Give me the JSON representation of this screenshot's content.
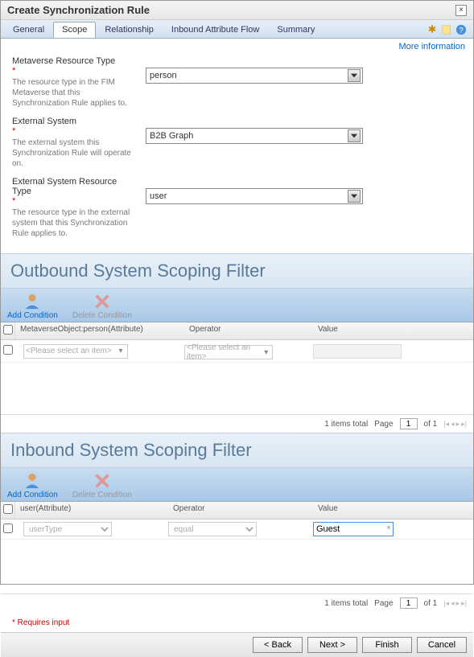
{
  "dialog": {
    "title": "Create Synchronization Rule",
    "close": "×"
  },
  "tabs": {
    "items": [
      "General",
      "Scope",
      "Relationship",
      "Inbound Attribute Flow",
      "Summary"
    ],
    "active_index": 1
  },
  "links": {
    "more_info": "More information"
  },
  "form": {
    "metaverse_type": {
      "label": "Metaverse Resource Type",
      "help": "The resource type in the FIM Metaverse that this Synchronization Rule applies to.",
      "value": "person"
    },
    "external_system": {
      "label": "External System",
      "help": "The external system this Synchronization Rule will operate on.",
      "value": "B2B Graph"
    },
    "external_type": {
      "label": "External System Resource Type",
      "help": "The resource type in the external system that this Synchronization Rule applies to.",
      "value": "user"
    }
  },
  "outbound": {
    "title": "Outbound System Scoping Filter",
    "toolbar": {
      "add": "Add Condition",
      "del": "Delete Condition"
    },
    "headers": {
      "attr": "MetaverseObject:person(Attribute)",
      "op": "Operator",
      "val": "Value"
    },
    "rows": [
      {
        "attr_placeholder": "<Please select an item>",
        "op_placeholder": "<Please select an item>",
        "val": ""
      }
    ],
    "pager": {
      "total": "1 items total",
      "page_label": "Page",
      "page": "1",
      "of": "of 1"
    }
  },
  "inbound": {
    "title": "Inbound System Scoping Filter",
    "toolbar": {
      "add": "Add Condition",
      "del": "Delete Condition"
    },
    "headers": {
      "attr": "user(Attribute)",
      "op": "Operator",
      "val": "Value"
    },
    "rows": [
      {
        "attr": "userType",
        "op": "equal",
        "val": "Guest"
      }
    ],
    "pager": {
      "total": "1 items total",
      "page_label": "Page",
      "page": "1",
      "of": "of 1"
    }
  },
  "footer": {
    "req_note": "* Requires input",
    "buttons": {
      "back": "< Back",
      "next": "Next >",
      "finish": "Finish",
      "cancel": "Cancel"
    }
  }
}
